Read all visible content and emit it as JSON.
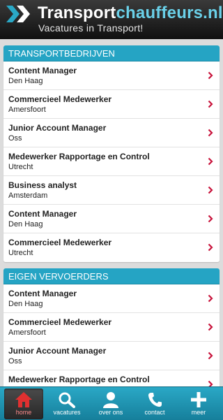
{
  "header": {
    "brand_part1": "Transport",
    "brand_part2": "chauffeurs.nl",
    "tagline": "Vacatures in Transport!"
  },
  "colors": {
    "accent": "#25a4c4",
    "brand_highlight": "#6ad0e8",
    "arrow": "#c8143c",
    "active_nav_icon": "#e03030"
  },
  "sections": [
    {
      "title": "TRANSPORTBEDRIJVEN",
      "jobs": [
        {
          "title": "Content Manager",
          "location": "Den Haag"
        },
        {
          "title": "Commercieel Medewerker",
          "location": "Amersfoort"
        },
        {
          "title": "Junior Account Manager",
          "location": "Oss"
        },
        {
          "title": "Medewerker Rapportage en Control",
          "location": "Utrecht"
        },
        {
          "title": "Business analyst",
          "location": "Amsterdam"
        },
        {
          "title": "Content Manager",
          "location": "Den Haag"
        },
        {
          "title": "Commercieel Medewerker",
          "location": "Utrecht"
        }
      ]
    },
    {
      "title": "EIGEN VERVOERDERS",
      "jobs": [
        {
          "title": "Content Manager",
          "location": "Den Haag"
        },
        {
          "title": "Commercieel Medewerker",
          "location": "Amersfoort"
        },
        {
          "title": "Junior Account Manager",
          "location": "Oss"
        },
        {
          "title": "Medewerker Rapportage en Control",
          "location": ""
        }
      ]
    }
  ],
  "nav": [
    {
      "label": "home",
      "icon": "home-icon",
      "active": true
    },
    {
      "label": "vacatures",
      "icon": "search-icon",
      "active": false
    },
    {
      "label": "over ons",
      "icon": "user-icon",
      "active": false
    },
    {
      "label": "contact",
      "icon": "phone-icon",
      "active": false
    },
    {
      "label": "meer",
      "icon": "plus-icon",
      "active": false
    }
  ]
}
